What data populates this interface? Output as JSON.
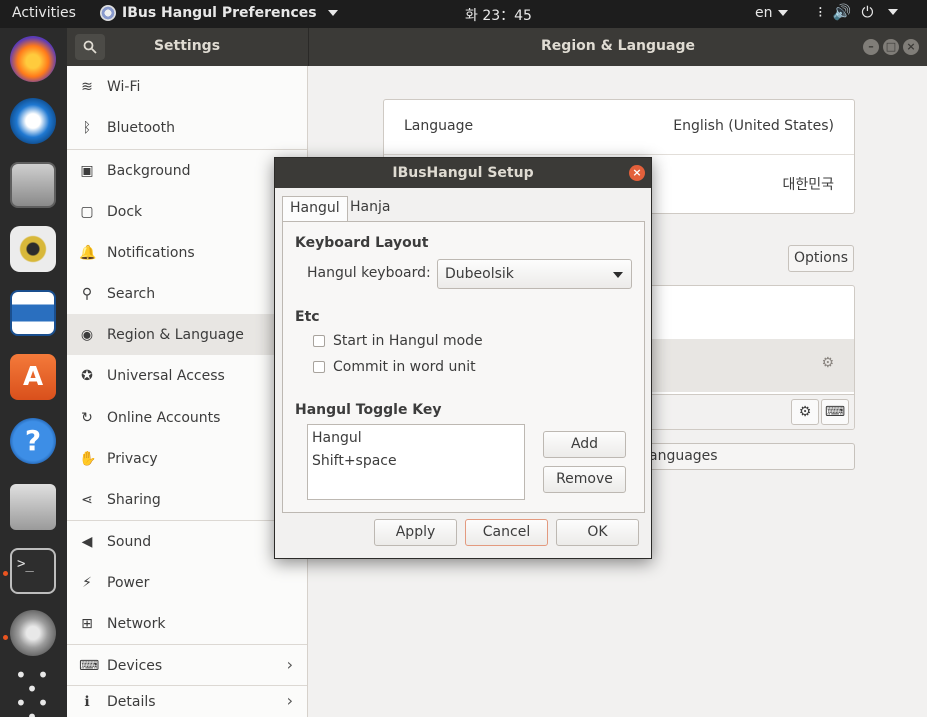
{
  "topbar": {
    "activities": "Activities",
    "app_name": "IBus Hangul Preferences",
    "clock": "화 23：45",
    "lang": "en"
  },
  "header": {
    "sidebar_title": "Settings",
    "main_title": "Region & Language"
  },
  "sidebar": {
    "items": [
      {
        "label": "Wi-Fi",
        "icon": "wifi-icon",
        "glyph": "≋"
      },
      {
        "label": "Bluetooth",
        "icon": "bluetooth-icon",
        "glyph": "ᛒ"
      },
      {
        "label": "Background",
        "icon": "background-icon",
        "glyph": "▣"
      },
      {
        "label": "Dock",
        "icon": "dock-icon",
        "glyph": "▢"
      },
      {
        "label": "Notifications",
        "icon": "bell-icon",
        "glyph": "🔔"
      },
      {
        "label": "Search",
        "icon": "search-icon",
        "glyph": "⚲"
      },
      {
        "label": "Region & Language",
        "icon": "camera-icon",
        "glyph": "◉"
      },
      {
        "label": "Universal Access",
        "icon": "accessibility-icon",
        "glyph": "✪"
      },
      {
        "label": "Online Accounts",
        "icon": "online-accounts-icon",
        "glyph": "↻"
      },
      {
        "label": "Privacy",
        "icon": "hand-icon",
        "glyph": "✋"
      },
      {
        "label": "Sharing",
        "icon": "share-icon",
        "glyph": "⋖"
      },
      {
        "label": "Sound",
        "icon": "speaker-icon",
        "glyph": "◀"
      },
      {
        "label": "Power",
        "icon": "power-plug-icon",
        "glyph": "⚡"
      },
      {
        "label": "Network",
        "icon": "network-icon",
        "glyph": "⊞"
      },
      {
        "label": "Devices",
        "icon": "devices-icon",
        "glyph": "⌨"
      },
      {
        "label": "Details",
        "icon": "info-icon",
        "glyph": "ℹ"
      }
    ]
  },
  "main": {
    "language_label": "Language",
    "language_value": "English (United States)",
    "formats_value": "대한민국",
    "options_label": "Options",
    "manage_label": "anguages"
  },
  "dialog": {
    "title": "IBusHangul Setup",
    "tabs": [
      "Hangul",
      "Hanja"
    ],
    "keyboard_layout_heading": "Keyboard Layout",
    "hangul_keyboard_label": "Hangul keyboard:",
    "hangul_keyboard_value": "Dubeolsik",
    "etc_heading": "Etc",
    "start_hangul_label": "Start in Hangul mode",
    "commit_word_label": "Commit in word unit",
    "toggle_key_heading": "Hangul Toggle Key",
    "toggle_keys": [
      "Hangul",
      "Shift+space"
    ],
    "add_label": "Add",
    "remove_label": "Remove",
    "apply_label": "Apply",
    "cancel_label": "Cancel",
    "ok_label": "OK"
  }
}
